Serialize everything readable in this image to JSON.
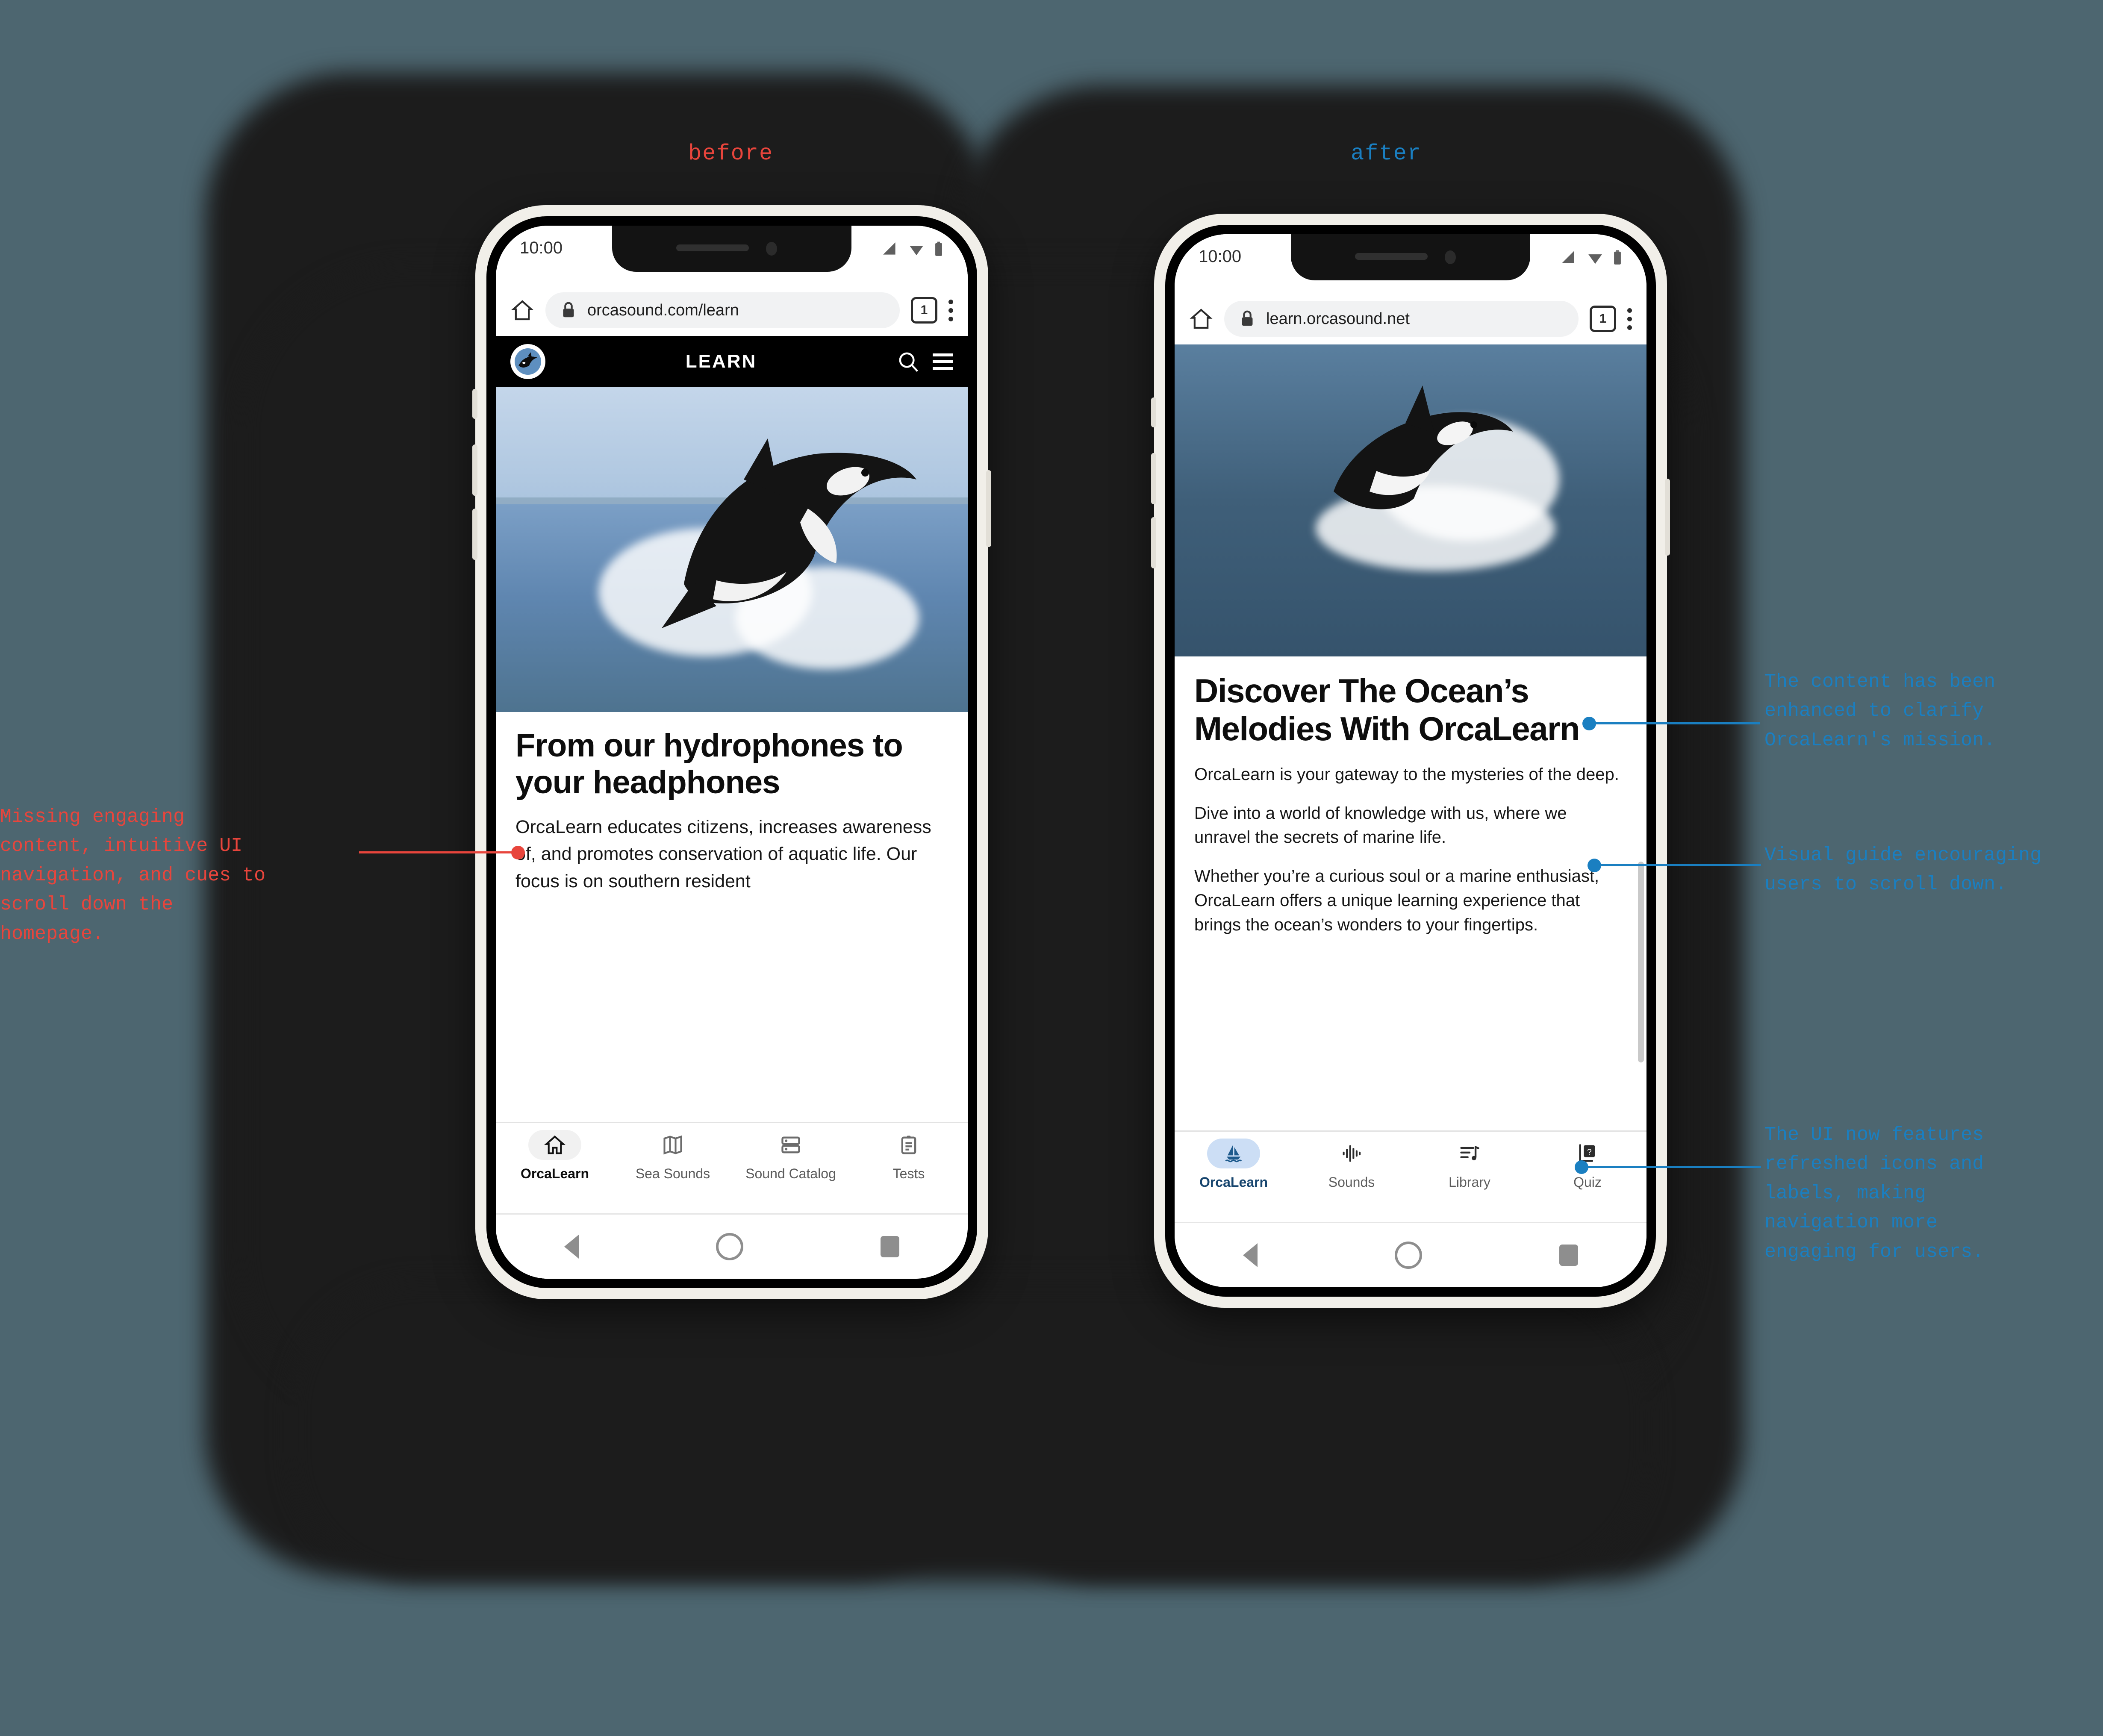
{
  "captions": {
    "before": "before",
    "after": "after"
  },
  "colors": {
    "background": "#4d6670",
    "blob": "#1c1c1c",
    "accent_red": "#e8453c",
    "accent_blue": "#1a7fc1",
    "nav_pill_after": "#ccdef5",
    "nav_label_after": "#17456e"
  },
  "phone_before": {
    "status": {
      "time": "10:00",
      "icons": [
        "signal-icon",
        "wifi-icon",
        "battery-icon"
      ]
    },
    "browser": {
      "home_icon": "home-icon",
      "lock_icon": "lock-icon",
      "url": "orcasound.com/learn",
      "tab_count": "1",
      "menu_icon": "kebab-menu-icon"
    },
    "site_header": {
      "logo": "orca-logo-icon",
      "title": "LEARN",
      "search_icon": "search-icon",
      "menu_icon": "hamburger-icon"
    },
    "hero": {
      "alt": "breaching-orca-photo"
    },
    "article": {
      "heading": "From our hydrophones to your headphones",
      "body": "OrcaLearn educates citizens, increases awareness of, and promotes conservation of aquatic life. Our focus is on southern resident"
    },
    "bottom_nav": {
      "selected_index": 0,
      "items": [
        {
          "label": "OrcaLearn",
          "icon": "home-outline-icon"
        },
        {
          "label": "Sea Sounds",
          "icon": "map-icon"
        },
        {
          "label": "Sound Catalog",
          "icon": "list-rows-icon"
        },
        {
          "label": "Tests",
          "icon": "clipboard-icon"
        }
      ]
    },
    "system_nav": {
      "back": "back-triangle-icon",
      "home": "home-circle-icon",
      "recents": "recents-square-icon"
    }
  },
  "phone_after": {
    "status": {
      "time": "10:00",
      "icons": [
        "signal-icon",
        "wifi-icon",
        "battery-icon"
      ]
    },
    "browser": {
      "home_icon": "home-icon",
      "lock_icon": "lock-icon",
      "url": "learn.orcasound.net",
      "tab_count": "1",
      "menu_icon": "kebab-menu-icon"
    },
    "hero": {
      "alt": "breaching-orca-photo"
    },
    "article": {
      "heading": "Discover The Ocean’s Melodies With OrcaLearn",
      "paragraphs": [
        "OrcaLearn is your gateway to the mysteries of the deep.",
        "Dive into a world of knowledge with us, where we unravel the secrets of marine life.",
        "Whether you’re a curious soul or a marine enthusiast, OrcaLearn offers a unique learning experience that brings the ocean’s wonders to your fingertips."
      ]
    },
    "bottom_nav": {
      "selected_index": 0,
      "items": [
        {
          "label": "OrcaLearn",
          "icon": "sailboat-icon"
        },
        {
          "label": "Sounds",
          "icon": "waveform-icon"
        },
        {
          "label": "Library",
          "icon": "playlist-music-icon"
        },
        {
          "label": "Quiz",
          "icon": "quiz-book-icon"
        }
      ]
    },
    "system_nav": {
      "back": "back-triangle-icon",
      "home": "home-circle-icon",
      "recents": "recents-square-icon"
    }
  },
  "annotations": {
    "left": [
      {
        "text": "Missing engaging\ncontent, intuitive UI\nnavigation, and cues to\nscroll down the\nhomepage.",
        "color": "red"
      }
    ],
    "right": [
      {
        "text": "The content has been\nenhanced to clarify\nOrcaLearn's mission.",
        "color": "blue"
      },
      {
        "text": "Visual guide encouraging\nusers to scroll down.",
        "color": "blue"
      },
      {
        "text": "The UI now features\nrefreshed icons and\nlabels, making\nnavigation more\nengaging for users.",
        "color": "blue"
      }
    ]
  }
}
